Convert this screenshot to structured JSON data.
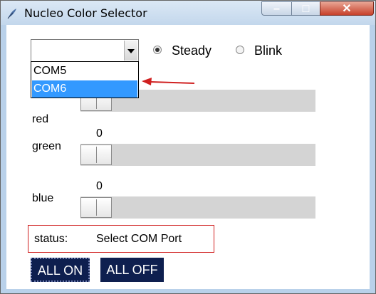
{
  "window": {
    "title": "Nucleo Color Selector",
    "controls": {
      "minimize": "–",
      "maximize": "□",
      "close": "✕"
    }
  },
  "port": {
    "selected": "",
    "options": [
      "COM5",
      "COM6"
    ],
    "highlighted": "COM6"
  },
  "mode": {
    "steady": "Steady",
    "blink": "Blink",
    "selected": "Steady"
  },
  "channels": {
    "red": {
      "label": "red",
      "value": "0"
    },
    "green": {
      "label": "green",
      "value": "0"
    },
    "blue": {
      "label": "blue",
      "value": "0"
    }
  },
  "status": {
    "label": "status:",
    "text": "Select COM Port"
  },
  "buttons": {
    "all_on": "ALL ON",
    "all_off": "ALL OFF"
  },
  "colors": {
    "annotation": "#d02020",
    "highlight": "#3399ff",
    "button": "#0e1f4f"
  },
  "icons": {
    "app": "feather-icon",
    "dropdown": "chevron-down-icon",
    "annotation": "arrow-left-icon"
  }
}
